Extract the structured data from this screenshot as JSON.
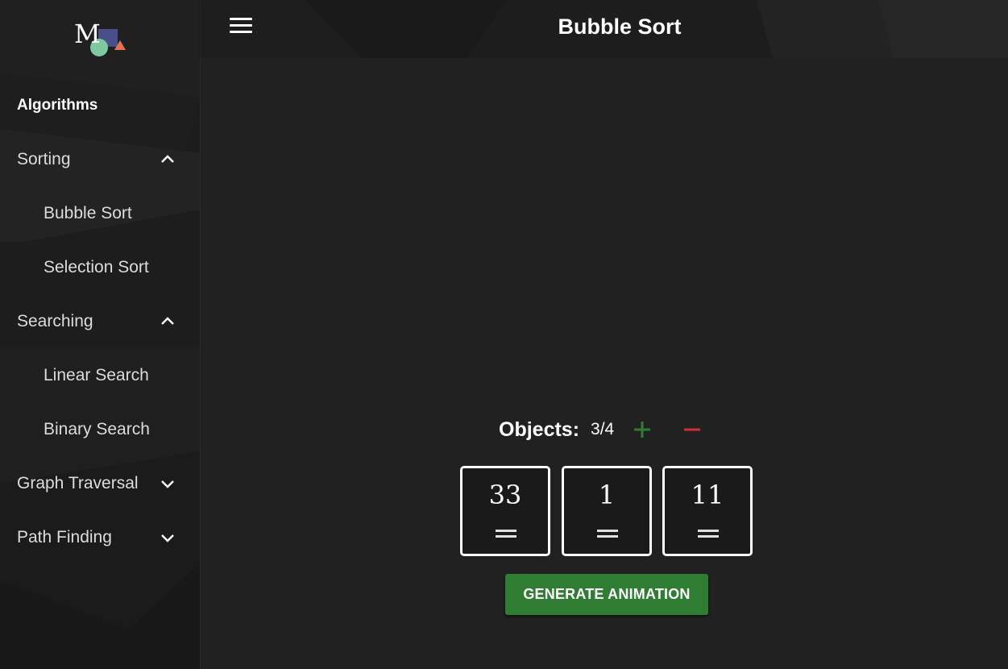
{
  "header": {
    "title": "Bubble Sort",
    "menu_icon": "hamburger-menu-icon"
  },
  "sidebar": {
    "logo_icon": "app-logo-icon",
    "heading": "Algorithms",
    "groups": [
      {
        "label": "Sorting",
        "expanded": true,
        "items": [
          "Bubble Sort",
          "Selection Sort"
        ]
      },
      {
        "label": "Searching",
        "expanded": true,
        "items": [
          "Linear Search",
          "Binary Search"
        ]
      },
      {
        "label": "Graph Traversal",
        "expanded": false,
        "items": []
      },
      {
        "label": "Path Finding",
        "expanded": false,
        "items": []
      }
    ]
  },
  "controls": {
    "objects_label": "Objects:",
    "objects_count": "3/4",
    "plus_icon": "plus-icon",
    "minus_icon": "minus-icon",
    "values": [
      "33",
      "1",
      "11"
    ],
    "generate_label": "GENERATE ANIMATION"
  },
  "colors": {
    "accent_green": "#2e7d32",
    "minus_red": "#d32f2f",
    "background": "#212121"
  }
}
